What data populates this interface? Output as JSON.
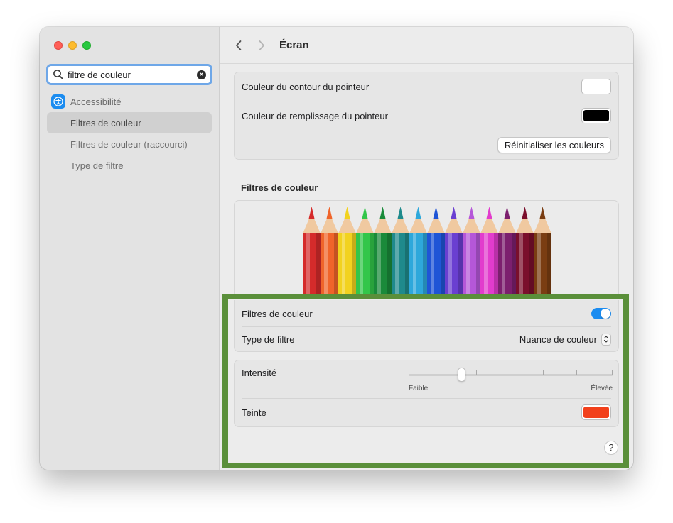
{
  "window": {
    "title": "Écran"
  },
  "sidebar": {
    "search": {
      "value": "filtre de couleur",
      "clear_icon": "clear-icon"
    },
    "section": {
      "label": "Accessibilité",
      "icon": "accessibility-icon"
    },
    "items": [
      {
        "label": "Filtres de couleur",
        "selected": true
      },
      {
        "label": "Filtres de couleur (raccourci)",
        "selected": false
      },
      {
        "label": "Type de filtre",
        "selected": false
      }
    ]
  },
  "toolbar": {
    "title": "Écran",
    "back_icon": "chevron-left-icon",
    "forward_icon": "chevron-right-icon"
  },
  "pointer": {
    "outline_label": "Couleur du contour du pointeur",
    "outline_color": "#ffffff",
    "fill_label": "Couleur de remplissage du pointeur",
    "fill_color": "#000000",
    "reset_label": "Réinitialiser les couleurs"
  },
  "filters": {
    "section_title": "Filtres de couleur",
    "pencil_colors": [
      "#d52b2b",
      "#f0642a",
      "#f2d21f",
      "#33c64a",
      "#1a8a3a",
      "#1f8a8c",
      "#2ea8db",
      "#1f55d6",
      "#6a3fd1",
      "#b557d8",
      "#e23ccd",
      "#7c1f6e",
      "#7a0f2c",
      "#7a3d12"
    ],
    "toggle_label": "Filtres de couleur",
    "toggle_on": true,
    "type_label": "Type de filtre",
    "type_value": "Nuance de couleur",
    "intensity_label": "Intensité",
    "intensity_value": 0.25,
    "intensity_min_label": "Faible",
    "intensity_max_label": "Élevée",
    "tint_label": "Teinte",
    "tint_color": "#f2401b",
    "help_label": "?"
  },
  "colors": {
    "accent": "#1b8cf0",
    "highlight": "#5a8f3a"
  }
}
